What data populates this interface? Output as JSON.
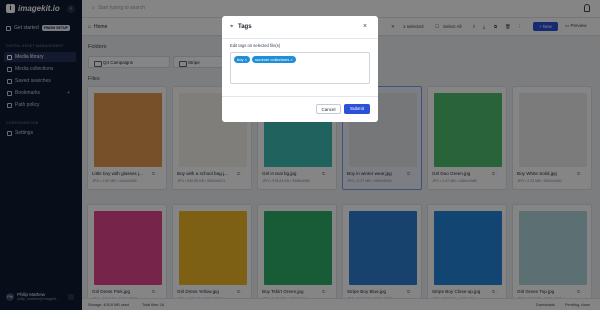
{
  "app": {
    "logo_letter": "i",
    "logo_text": "imagekit.io",
    "collapse_icon": "chevron-left-icon"
  },
  "sidebar": {
    "get_started": "Get started",
    "setup_badge": "FINISH SETUP",
    "dam_title": "DIGITAL ASSET MANAGEMENT",
    "items": [
      {
        "label": "Media library",
        "icon": "image-icon",
        "active": true
      },
      {
        "label": "Media collections",
        "icon": "collection-icon"
      },
      {
        "label": "Saved searches",
        "icon": "search-icon"
      },
      {
        "label": "Bookmarks",
        "icon": "bookmark-icon"
      },
      {
        "label": "Path policy",
        "icon": "policy-icon"
      }
    ],
    "config_title": "CONFIGURATION",
    "settings": "Settings"
  },
  "user": {
    "initials": "PM",
    "name": "Philip Mathew",
    "email": "philip_mathew@imagekit..."
  },
  "topbar": {
    "search_placeholder": "Start typing to search"
  },
  "toolbar": {
    "home": "Home",
    "selected": "1 selected",
    "select_all": "Select All",
    "new": "+ New",
    "preview": "Preview"
  },
  "folders_heading": "Folders",
  "folders": [
    {
      "name": "Q4 Campaigns"
    },
    {
      "name": "Stripe"
    }
  ],
  "files_heading": "Files",
  "files": [
    {
      "name": "Little boy with glasses j...",
      "meta": "JPG • 1.50 MB • 4444x5555",
      "color": "#e59a52",
      "selected": false
    },
    {
      "name": "Boy with a school bag.j...",
      "meta": "JPG • 630.55 KB • 5503x6423",
      "color": "#f3f1ec",
      "selected": false
    },
    {
      "name": "Girl in teal bg.jpg",
      "meta": "JPG • 978.83 KB • 3008x3960",
      "color": "#3cbcb5",
      "selected": false
    },
    {
      "name": "Boy in winter wear.jpg",
      "meta": "JPG • 2.27 MB • 4000x6000",
      "color": "#e3e4e6",
      "selected": true
    },
    {
      "name": "Girl Duo Green.jpg",
      "meta": "JPG • 3.47 MB • 4484x2988",
      "color": "#4fbe6e",
      "selected": false
    },
    {
      "name": "Boy White Solid.jpg",
      "meta": "JPG • 2.23 MB • 6000x4000",
      "color": "#ebeced",
      "selected": false
    },
    {
      "name": "Girl Dress Pink.jpg",
      "meta": "JPG • 1.38 MB • 5000x3957",
      "color": "#e2458c",
      "selected": false
    },
    {
      "name": "Girl Dress Yellow.jpg",
      "meta": "JPG • 1.35 MB • 5583x3950",
      "color": "#f1b92a",
      "selected": false
    },
    {
      "name": "Boy Tshirt Green.jpg",
      "meta": "JPG • 1.47 MB • 4000x2642",
      "color": "#2db06a",
      "selected": false
    },
    {
      "name": "Stripe Boy Blue.jpg",
      "meta": "JPG • 3.01 MB • 5921x3950",
      "color": "#2c7fd4",
      "selected": false
    },
    {
      "name": "Stripe Boy Close-up.jpg",
      "meta": "JPG • 2.51 MB • 4000x2554",
      "color": "#2385d8",
      "selected": false
    },
    {
      "name": "Girl Green Top.jpg",
      "meta": "JPG • 2.53 MB • 6000x4000",
      "color": "#b1d7dc",
      "selected": false
    }
  ],
  "footer": {
    "storage": "Storage: 405.8 MB used",
    "total": "Total files: 16",
    "downloads": "Downloads",
    "pending": "Pending, close"
  },
  "modal": {
    "title": "Tags",
    "label": "Edit tags on selected file(s)",
    "tags": [
      "boy",
      "summer collections"
    ],
    "cancel": "Cancel",
    "submit": "Submit"
  },
  "colors": {
    "sidebar_bg": "#0f1a30",
    "accent": "#2a51d6",
    "chip": "#1f8fd8"
  }
}
